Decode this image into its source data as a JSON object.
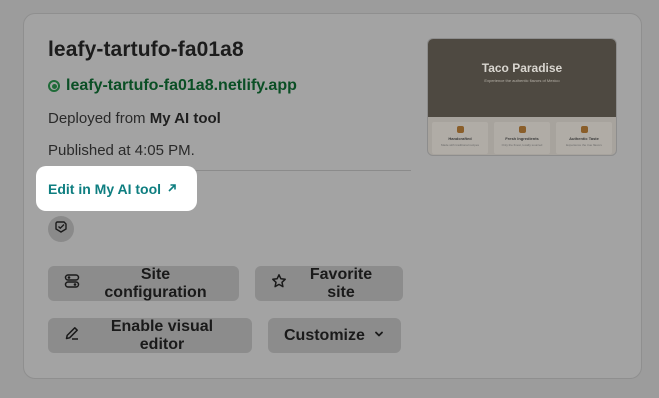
{
  "site": {
    "name": "leafy-tartufo-fa01a8",
    "url": "leafy-tartufo-fa01a8.netlify.app",
    "deployed_prefix": "Deployed from",
    "deployed_source": "My AI tool",
    "published": "Published at 4:05 PM.",
    "edit_link": "Edit in My AI tool",
    "status_color": "#1f6b38"
  },
  "preview": {
    "title": "Taco Paradise",
    "subtitle": "Experience the authentic flavors of Mexico",
    "cards": [
      {
        "label": "Handcrafted",
        "text": "Made with traditional recipes"
      },
      {
        "label": "Fresh Ingredients",
        "text": "Only the finest, locally sourced"
      },
      {
        "label": "Authentic Taste",
        "text": "Experience the true flavors"
      }
    ]
  },
  "actions": {
    "site_configuration": "Site configuration",
    "favorite_site": "Favorite site",
    "enable_visual_editor": "Enable visual editor",
    "customize": "Customize"
  },
  "icons": {
    "status": "status-dot-icon",
    "external": "external-arrow-icon",
    "badge": "verified-badge-icon",
    "config": "toggle-settings-icon",
    "favorite": "star-icon",
    "edit": "pencil-icon",
    "dropdown": "chevron-down-icon"
  },
  "colors": {
    "link_teal": "#0e7e80",
    "url_green": "#0b4f25",
    "overlay_gray": "#9c9c9c"
  }
}
